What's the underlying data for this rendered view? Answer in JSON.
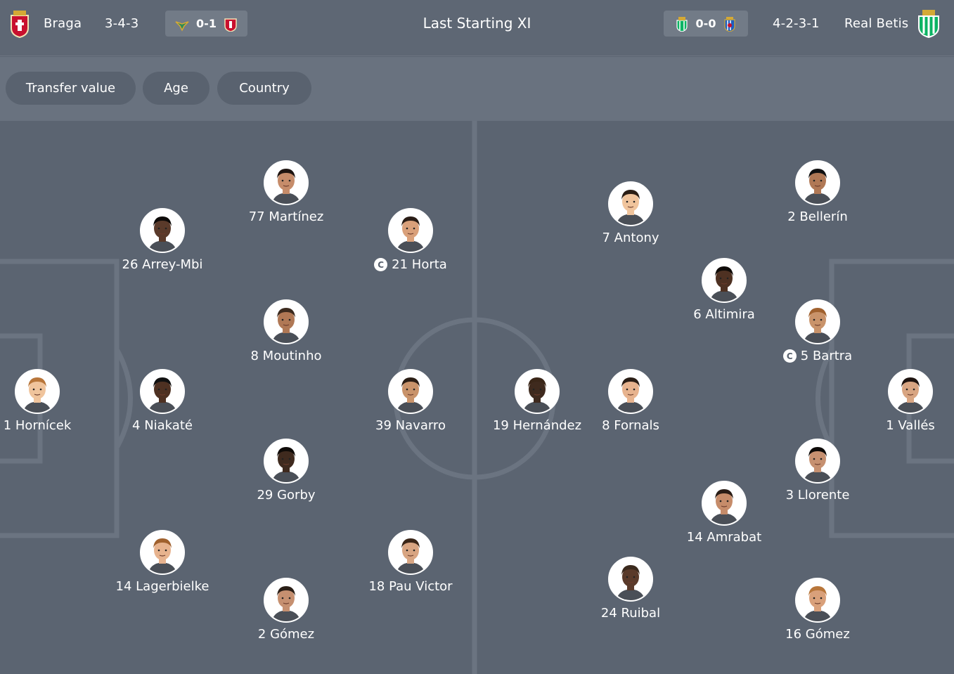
{
  "header": {
    "title": "Last Starting XI",
    "home": {
      "name": "Braga",
      "formation": "3-4-3",
      "last_score": "0-1",
      "crest_icon": "braga-crest-icon",
      "opponent_crest_icon": "moreirense-crest-icon"
    },
    "away": {
      "name": "Real Betis",
      "formation": "4-2-3-1",
      "last_score": "0-0",
      "crest_icon": "betis-crest-icon",
      "opponent_crest_icon": "espanyol-crest-icon"
    }
  },
  "filters": [
    "Transfer value",
    "Age",
    "Country"
  ],
  "home_players": [
    {
      "label": "77 Martínez",
      "captain": false
    },
    {
      "label": "26 Arrey-Mbi",
      "captain": false
    },
    {
      "label": "21 Horta",
      "captain": true
    },
    {
      "label": "8 Moutinho",
      "captain": false
    },
    {
      "label": "1 Hornícek",
      "captain": false
    },
    {
      "label": "4 Niakaté",
      "captain": false
    },
    {
      "label": "39 Navarro",
      "captain": false
    },
    {
      "label": "29 Gorby",
      "captain": false
    },
    {
      "label": "14 Lagerbielke",
      "captain": false
    },
    {
      "label": "18 Pau Victor",
      "captain": false
    },
    {
      "label": "2 Gómez",
      "captain": false
    }
  ],
  "away_players": [
    {
      "label": "2 Bellerín",
      "captain": false
    },
    {
      "label": "7 Antony",
      "captain": false
    },
    {
      "label": "6 Altimira",
      "captain": false
    },
    {
      "label": "5 Bartra",
      "captain": true
    },
    {
      "label": "19 Hernández",
      "captain": false
    },
    {
      "label": "8 Fornals",
      "captain": false
    },
    {
      "label": "1 Vallés",
      "captain": false
    },
    {
      "label": "3 Llorente",
      "captain": false
    },
    {
      "label": "14 Amrabat",
      "captain": false
    },
    {
      "label": "24 Ruibal",
      "captain": false
    },
    {
      "label": "16 Gómez",
      "captain": false
    }
  ],
  "captain_mark": "C",
  "colors": {
    "pitch": "#5b6471",
    "header": "#5e6774",
    "filterbar": "#69727f",
    "chip": "#59626f",
    "lines": "#6b7481"
  }
}
